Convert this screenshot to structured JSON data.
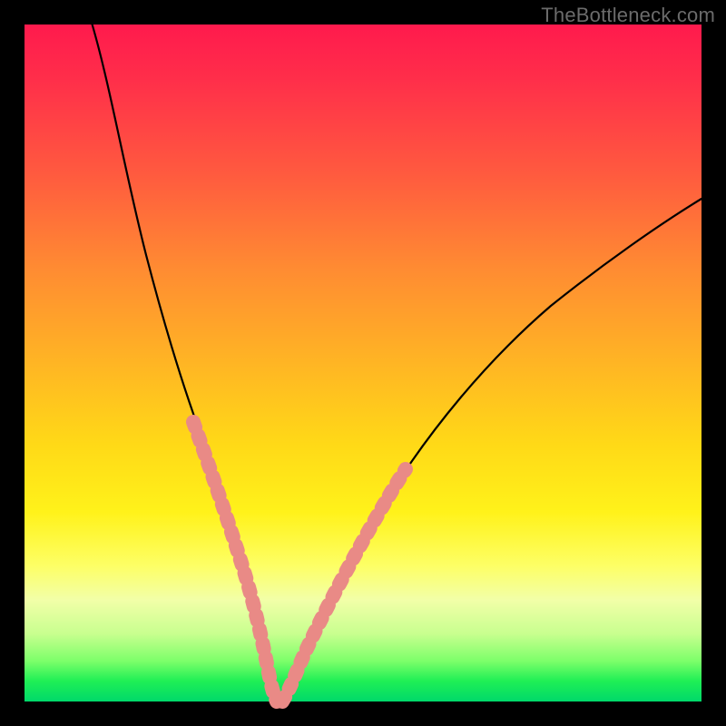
{
  "watermark": "TheBottleneck.com",
  "colors": {
    "frame_bg": "#000000",
    "curve": "#000000",
    "beads": "#e98a86"
  },
  "chart_data": {
    "type": "line",
    "title": "",
    "xlabel": "",
    "ylabel": "",
    "xlim": [
      0,
      100
    ],
    "ylim": [
      0,
      100
    ],
    "grid": false,
    "legend": false,
    "background": "rainbow-vertical",
    "series": [
      {
        "name": "bottleneck-curve",
        "x": [
          10,
          14,
          18,
          22,
          26,
          29,
          31,
          33,
          34,
          35,
          36,
          37,
          38,
          39,
          41,
          44,
          48,
          54,
          62,
          72,
          84,
          96,
          100
        ],
        "values": [
          100,
          82,
          66,
          51,
          38,
          28,
          21,
          14,
          9,
          5,
          2,
          0,
          0,
          2,
          6,
          12,
          21,
          33,
          46,
          58,
          68,
          75,
          78
        ]
      }
    ],
    "annotations": [
      {
        "name": "bead-overlay",
        "type": "dotted-overlay",
        "along": "bottleneck-curve",
        "x_range": [
          24,
          50
        ],
        "note": "salmon dotted beads along lower valley of curve"
      }
    ]
  }
}
